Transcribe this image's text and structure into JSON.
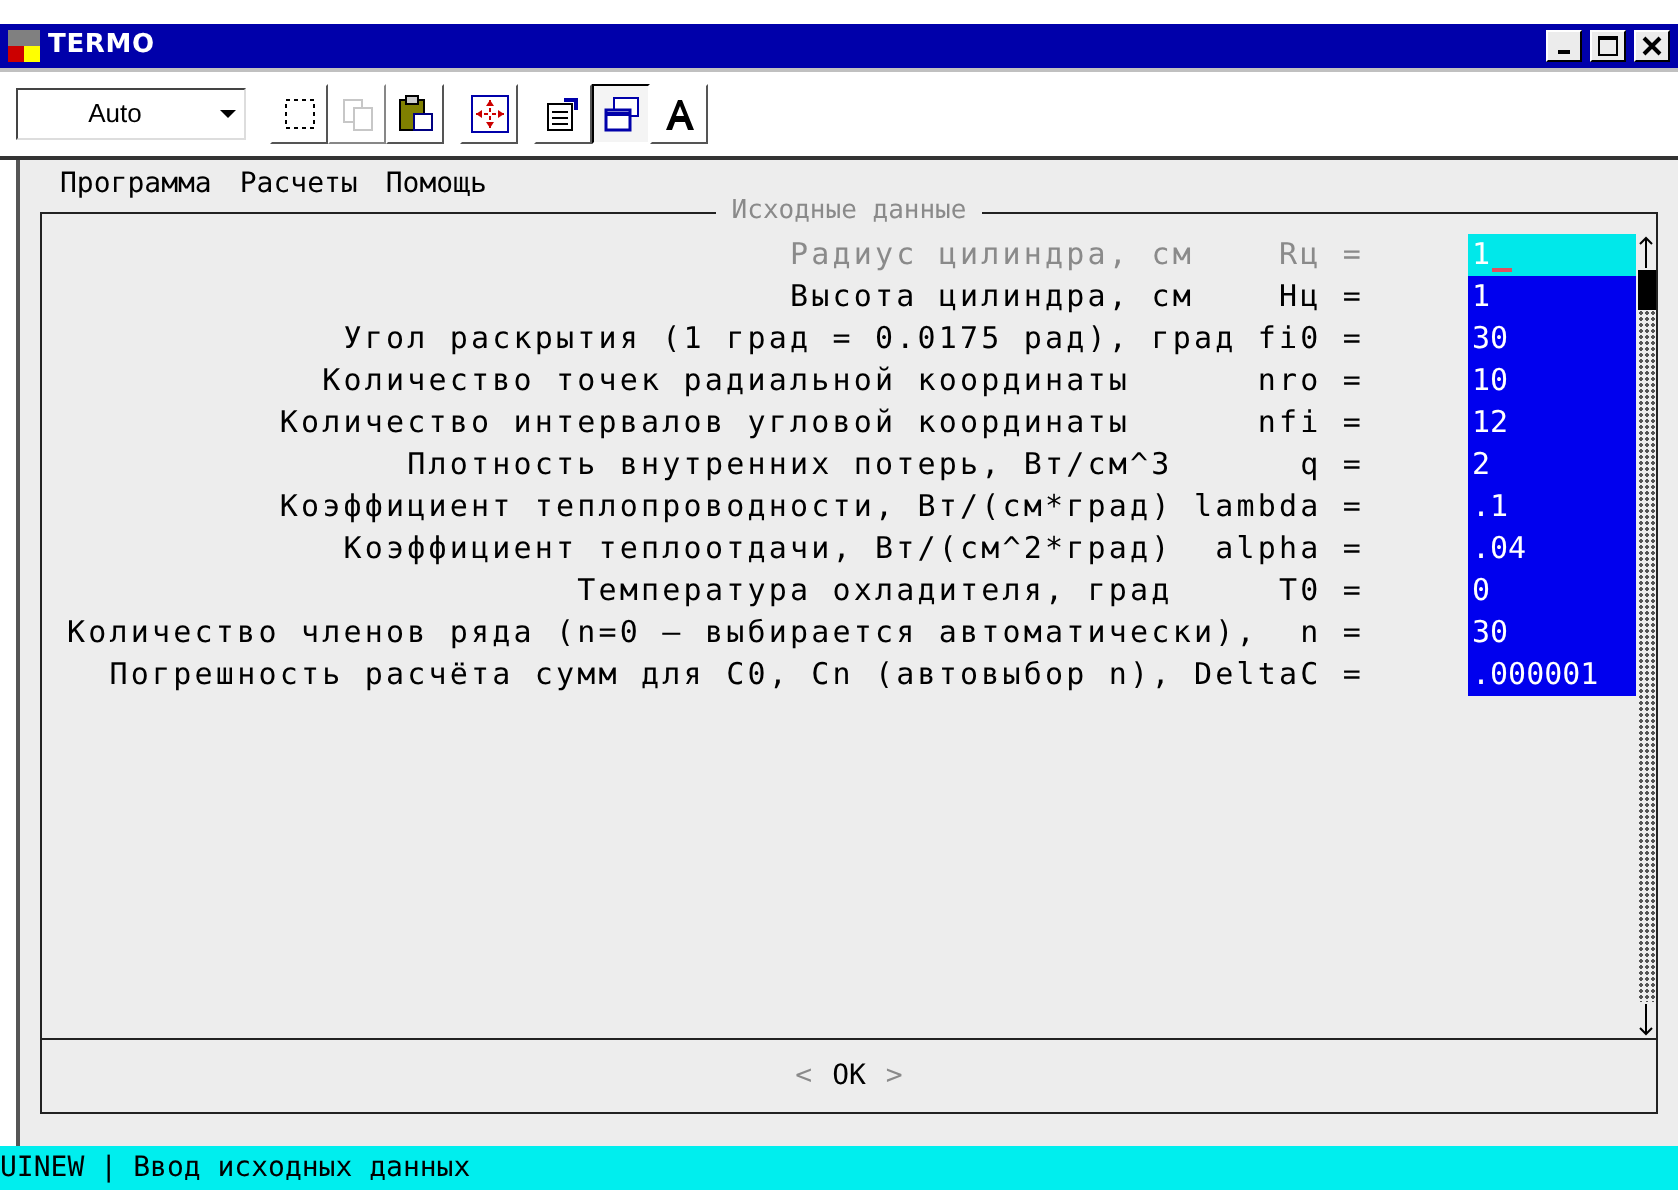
{
  "window": {
    "title": "TERMO"
  },
  "toolbar": {
    "combo": {
      "value": "Auto"
    },
    "buttons": [
      {
        "kind": "select",
        "disabled": false,
        "pressed": false
      },
      {
        "kind": "copy",
        "disabled": true,
        "pressed": false
      },
      {
        "kind": "paste",
        "disabled": false,
        "pressed": false
      },
      {
        "kind": "fit",
        "disabled": false,
        "pressed": false
      },
      {
        "kind": "properties",
        "disabled": false,
        "pressed": false
      },
      {
        "kind": "window",
        "disabled": false,
        "pressed": true
      },
      {
        "kind": "font",
        "disabled": false,
        "pressed": false
      }
    ]
  },
  "menu": [
    "Программа",
    "Расчеты",
    "Помощь"
  ],
  "dialog": {
    "group_title": "Исходные данные",
    "rows": [
      {
        "label": "Радиус цилиндра, см    Rц =",
        "value": "1",
        "selected": true
      },
      {
        "label": "Высота цилиндра, см    Hц =",
        "value": "1",
        "selected": false
      },
      {
        "label": "Угол раскрытия (1 град = 0.0175 рад), град fi0 =",
        "value": "30",
        "selected": false
      },
      {
        "label": "Количество точек радиальной координаты      nro =",
        "value": "10",
        "selected": false
      },
      {
        "label": "Количество интервалов угловой координаты      nfi =",
        "value": "12",
        "selected": false
      },
      {
        "label": "Плотность внутренних потерь, Вт/см^3      q =",
        "value": "2",
        "selected": false
      },
      {
        "label": "Коэффициент теплопроводности, Вт/(см*град) lambda =",
        "value": ".1",
        "selected": false
      },
      {
        "label": "Коэффициент теплоотдачи, Вт/(см^2*град)  alpha =",
        "value": ".04",
        "selected": false
      },
      {
        "label": "Температура охладителя, град     T0 =",
        "value": "0",
        "selected": false
      },
      {
        "label": "Количество членов ряда (n=0 – выбирается автоматически),  n =",
        "value": "30",
        "selected": false
      },
      {
        "label": "Погрешность расчёта сумм для C0, Cn (автовыбор n), DeltaC =",
        "value": ".000001",
        "selected": false
      }
    ],
    "ok_button": {
      "left_mark": "<",
      "label": "OK",
      "right_mark": ">"
    }
  },
  "status_bar": {
    "module": "UINEW",
    "separator": "|",
    "text": "Ввод исходных данных"
  }
}
